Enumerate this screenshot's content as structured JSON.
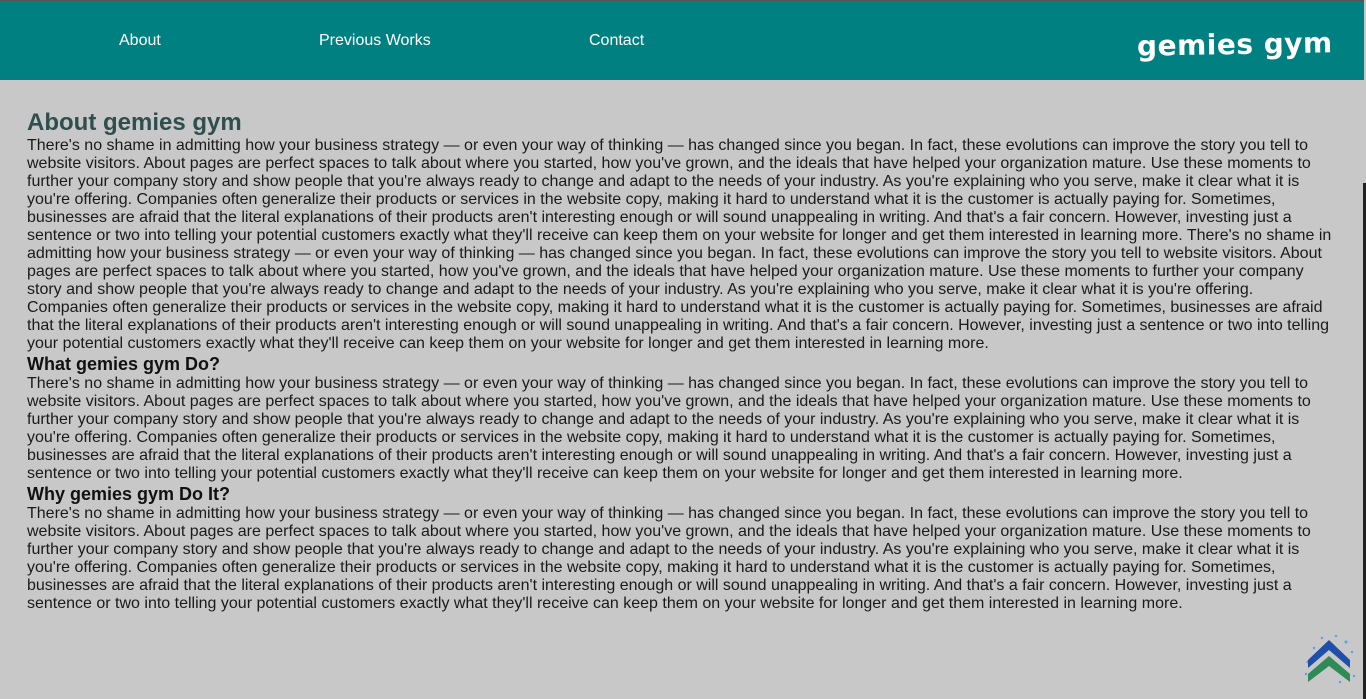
{
  "nav": {
    "links": [
      {
        "label": "About"
      },
      {
        "label": "Previous Works"
      },
      {
        "label": "Contact"
      }
    ],
    "brand": "gemies gym"
  },
  "main": {
    "title": "About gemies gym",
    "intro": "There's no shame in admitting how your business strategy — or even your way of thinking — has changed since you began. In fact, these evolutions can improve the story you tell to website visitors. About pages are perfect spaces to talk about where you started, how you've grown, and the ideals that have helped your organization mature. Use these moments to further your company story and show people that you're always ready to change and adapt to the needs of your industry. As you're explaining who you serve, make it clear what it is you're offering. Companies often generalize their products or services in the website copy, making it hard to understand what it is the customer is actually paying for. Sometimes, businesses are afraid that the literal explanations of their products aren't interesting enough or will sound unappealing in writing. And that's a fair concern. However, investing just a sentence or two into telling your potential customers exactly what they'll receive can keep them on your website for longer and get them interested in learning more. There's no shame in admitting how your business strategy — or even your way of thinking — has changed since you began. In fact, these evolutions can improve the story you tell to website visitors. About pages are perfect spaces to talk about where you started, how you've grown, and the ideals that have helped your organization mature. Use these moments to further your company story and show people that you're always ready to change and adapt to the needs of your industry. As you're explaining who you serve, make it clear what it is you're offering. Companies often generalize their products or services in the website copy, making it hard to understand what it is the customer is actually paying for. Sometimes, businesses are afraid that the literal explanations of their products aren't interesting enough or will sound unappealing in writing. And that's a fair concern. However, investing just a sentence or two into telling your potential customers exactly what they'll receive can keep them on your website for longer and get them interested in learning more.",
    "sections": [
      {
        "heading": "What gemies gym Do?",
        "body": "There's no shame in admitting how your business strategy — or even your way of thinking — has changed since you began. In fact, these evolutions can improve the story you tell to website visitors. About pages are perfect spaces to talk about where you started, how you've grown, and the ideals that have helped your organization mature. Use these moments to further your company story and show people that you're always ready to change and adapt to the needs of your industry. As you're explaining who you serve, make it clear what it is you're offering. Companies often generalize their products or services in the website copy, making it hard to understand what it is the customer is actually paying for. Sometimes, businesses are afraid that the literal explanations of their products aren't interesting enough or will sound unappealing in writing. And that's a fair concern. However, investing just a sentence or two into telling your potential customers exactly what they'll receive can keep them on your website for longer and get them interested in learning more."
      },
      {
        "heading": "Why gemies gym Do It?",
        "body": "There's no shame in admitting how your business strategy — or even your way of thinking — has changed since you began. In fact, these evolutions can improve the story you tell to website visitors. About pages are perfect spaces to talk about where you started, how you've grown, and the ideals that have helped your organization mature. Use these moments to further your company story and show people that you're always ready to change and adapt to the needs of your industry. As you're explaining who you serve, make it clear what it is you're offering. Companies often generalize their products or services in the website copy, making it hard to understand what it is the customer is actually paying for. Sometimes, businesses are afraid that the literal explanations of their products aren't interesting enough or will sound unappealing in writing. And that's a fair concern. However, investing just a sentence or two into telling your potential customers exactly what they'll receive can keep them on your website for longer and get them interested in learning more."
      }
    ]
  },
  "scroll_top_icon": "double-chevron-up-icon",
  "colors": {
    "navbar": "#008080",
    "background": "#c8c8c8",
    "title": "#2f4f4f",
    "scroll_top_dark": "#1f4fa8",
    "scroll_top_green": "#2e8b57"
  }
}
